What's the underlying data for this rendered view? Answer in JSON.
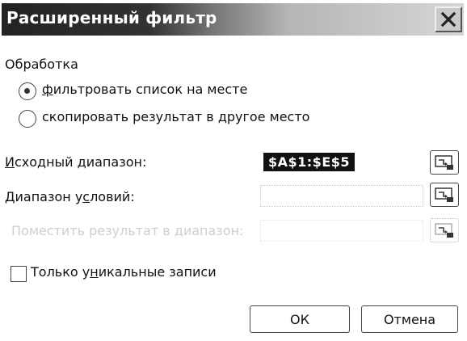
{
  "window": {
    "title": "Расширенный фильтр"
  },
  "icons": {
    "close": "close-icon",
    "range_select": "range-select-icon"
  },
  "processing": {
    "group_label": "Обработка",
    "options": [
      {
        "pre": "",
        "key": "ф",
        "post": "ильтровать список на месте",
        "checked": true
      },
      {
        "pre": "скопировать результат в ",
        "key": "д",
        "post": "ругое место",
        "checked": false
      }
    ]
  },
  "source_range": {
    "label_key": "И",
    "label_rest": "сходный диапазон:",
    "value": "$A$1:$E$5"
  },
  "criteria_range": {
    "label_pre": "Диапазон у",
    "label_key": "с",
    "label_post": "ловий:",
    "value": ""
  },
  "copy_to": {
    "label": "Поместить результат в диапазон:",
    "value": ""
  },
  "unique_only": {
    "pre": "Только у",
    "key": "н",
    "post": "икальные записи",
    "checked": false
  },
  "buttons": {
    "ok": "ОК",
    "cancel": "Отмена"
  }
}
